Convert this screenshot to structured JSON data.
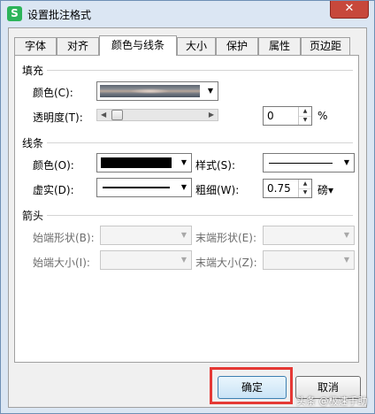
{
  "window": {
    "title": "设置批注格式",
    "app_icon_glyph": "S",
    "close_glyph": "✕"
  },
  "tabs": [
    {
      "label": "字体"
    },
    {
      "label": "对齐"
    },
    {
      "label": "颜色与线条"
    },
    {
      "label": "大小"
    },
    {
      "label": "保护"
    },
    {
      "label": "属性"
    },
    {
      "label": "页边距"
    }
  ],
  "active_tab": "颜色与线条",
  "fill": {
    "section_title": "填充",
    "color_label": "颜色(C):",
    "color_value": "texture-image",
    "transparency_label": "透明度(T):",
    "transparency_value": "0",
    "transparency_unit": "%",
    "transparency_fraction": 0
  },
  "line": {
    "section_title": "线条",
    "color_label": "颜色(O):",
    "color_value": "#000000",
    "style_label": "样式(S):",
    "dash_label": "虚实(D):",
    "weight_label": "粗细(W):",
    "weight_value": "0.75",
    "weight_unit": "磅▾"
  },
  "arrows": {
    "section_title": "箭头",
    "begin_style_label": "始端形状(B):",
    "end_style_label": "末端形状(E):",
    "begin_size_label": "始端大小(I):",
    "end_size_label": "末端大小(Z):"
  },
  "buttons": {
    "ok": "确定",
    "cancel": "取消"
  },
  "watermark": "头条 @极速手助",
  "colors": {
    "highlight": "#e53935",
    "close_button": "#c7483b",
    "app_icon": "#2db45a"
  }
}
